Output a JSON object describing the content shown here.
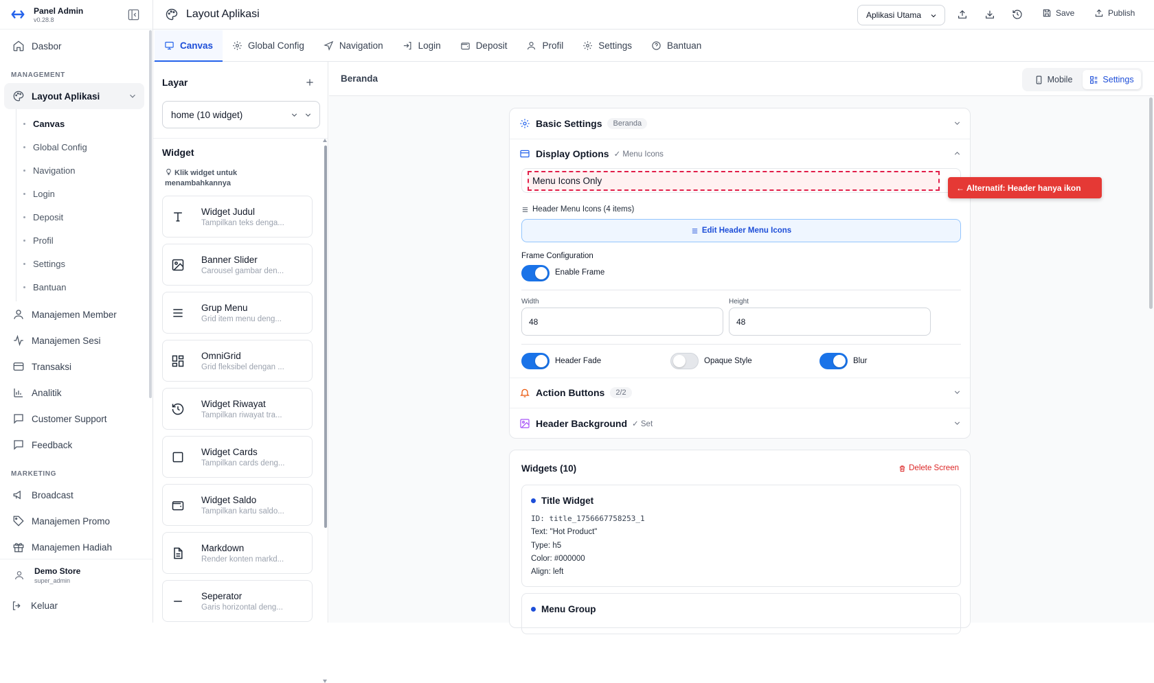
{
  "brand": {
    "title": "Panel Admin",
    "version": "v0.28.8"
  },
  "sidebar": {
    "top_item": {
      "label": "Dasbor",
      "icon": "home-icon"
    },
    "sections": {
      "management": "MANAGEMENT",
      "marketing": "MARKETING"
    },
    "active_group": {
      "label": "Layout Aplikasi",
      "icon": "palette-icon"
    },
    "sub_items": [
      "Canvas",
      "Global Config",
      "Navigation",
      "Login",
      "Deposit",
      "Profil",
      "Settings",
      "Bantuan"
    ],
    "management_items": [
      {
        "label": "Manajemen Member",
        "icon": "user-icon"
      },
      {
        "label": "Manajemen Sesi",
        "icon": "activity-icon"
      },
      {
        "label": "Transaksi",
        "icon": "credit-card-icon"
      },
      {
        "label": "Analitik",
        "icon": "bar-chart-icon"
      },
      {
        "label": "Customer Support",
        "icon": "message-icon"
      },
      {
        "label": "Feedback",
        "icon": "message-square-icon"
      }
    ],
    "marketing_items": [
      {
        "label": "Broadcast",
        "icon": "megaphone-icon"
      },
      {
        "label": "Manajemen Promo",
        "icon": "tag-icon"
      },
      {
        "label": "Manajemen Hadiah",
        "icon": "gift-icon"
      }
    ],
    "user": {
      "name": "Demo Store",
      "role": "super_admin"
    },
    "logout": "Keluar"
  },
  "topbar": {
    "title": "Layout Aplikasi",
    "app_select": "Aplikasi Utama",
    "save": "Save",
    "publish": "Publish"
  },
  "tabs": [
    "Canvas",
    "Global Config",
    "Navigation",
    "Login",
    "Deposit",
    "Profil",
    "Settings",
    "Bantuan"
  ],
  "layers": {
    "title": "Layar",
    "screen_select": "home (10 widget)",
    "widget_title": "Widget",
    "hint": "Klik widget untuk menambahkannya",
    "widgets": [
      {
        "name": "Widget Judul",
        "desc": "Tampilkan teks denga...",
        "icon": "text-icon"
      },
      {
        "name": "Banner Slider",
        "desc": "Carousel gambar den...",
        "icon": "image-icon"
      },
      {
        "name": "Grup Menu",
        "desc": "Grid item menu deng...",
        "icon": "menu-lines-icon"
      },
      {
        "name": "OmniGrid",
        "desc": "Grid fleksibel dengan ...",
        "icon": "grid-icon"
      },
      {
        "name": "Widget Riwayat",
        "desc": "Tampilkan riwayat tra...",
        "icon": "history-icon"
      },
      {
        "name": "Widget Cards",
        "desc": "Tampilkan cards deng...",
        "icon": "square-icon"
      },
      {
        "name": "Widget Saldo",
        "desc": "Tampilkan kartu saldo...",
        "icon": "wallet-icon"
      },
      {
        "name": "Markdown",
        "desc": "Render konten markd...",
        "icon": "file-text-icon"
      },
      {
        "name": "Seperator",
        "desc": "Garis horizontal deng...",
        "icon": "minus-icon"
      }
    ]
  },
  "main": {
    "title": "Beranda",
    "view_mobile": "Mobile",
    "view_settings": "Settings",
    "basic": {
      "title": "Basic Settings",
      "badge": "Beranda"
    },
    "display": {
      "title": "Display Options",
      "sub": "✓ Menu Icons",
      "mode": "Menu Icons Only",
      "header_icons_label": "Header Menu Icons (4 items)",
      "edit_button": "Edit Header Menu Icons",
      "frame_config": "Frame Configuration",
      "enable_frame": "Enable Frame",
      "width_label": "Width",
      "width_value": "48",
      "height_label": "Height",
      "height_value": "48",
      "header_fade": "Header Fade",
      "opaque_style": "Opaque Style",
      "blur": "Blur"
    },
    "action": {
      "title": "Action Buttons",
      "badge": "2/2"
    },
    "background": {
      "title": "Header Background",
      "sub": "✓ Set"
    },
    "callout": "← Alternatif: Header hanya ikon",
    "widgets_panel": {
      "title": "Widgets (10)",
      "delete": "Delete Screen",
      "card1": {
        "title": "Title Widget",
        "id": "ID: title_1756667758253_1",
        "text": "Text: \"Hot Product\"",
        "type": "Type: h5",
        "color": "Color: #000000",
        "align": "Align: left"
      },
      "card2": {
        "title": "Menu Group"
      }
    }
  },
  "colors": {
    "accent": "#2563eb",
    "callout": "#e53935",
    "toggle_on": "#1a73e8"
  }
}
